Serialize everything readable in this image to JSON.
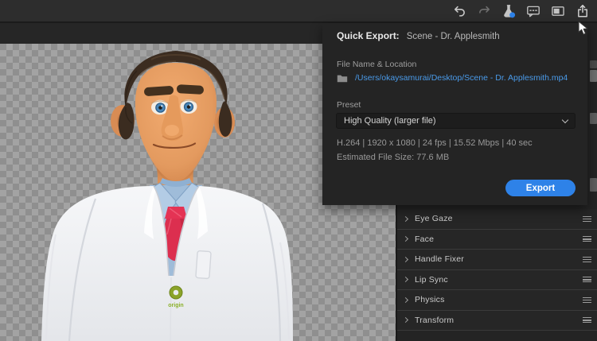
{
  "toolbar": {
    "icons": [
      {
        "name": "undo"
      },
      {
        "name": "redo"
      },
      {
        "name": "experimental-flask"
      },
      {
        "name": "feedback-chat"
      },
      {
        "name": "panel-layout"
      },
      {
        "name": "share-export"
      }
    ]
  },
  "quick_export": {
    "title": "Quick Export:",
    "scene_name": "Scene - Dr. Applesmith",
    "file_section_label": "File Name & Location",
    "file_path": "/Users/okaysamurai/Desktop/Scene - Dr. Applesmith.mp4",
    "preset_label": "Preset",
    "preset_value": "High Quality (larger file)",
    "specs": "H.264 | 1920 x 1080 | 24 fps | 15.52 Mbps | 40 sec",
    "estimated_size": "Estimated File Size: 77.6 MB",
    "export_button": "Export",
    "accent_color": "#2e82e8",
    "link_color": "#4a9bea"
  },
  "behaviors_panel": {
    "items": [
      {
        "label": "Eye Gaze"
      },
      {
        "label": "Face"
      },
      {
        "label": "Handle Fixer"
      },
      {
        "label": "Lip Sync"
      },
      {
        "label": "Physics"
      },
      {
        "label": "Transform"
      }
    ]
  },
  "character": {
    "scene_title": "Scene - Dr. Applesmith",
    "badge_label": "origin"
  }
}
